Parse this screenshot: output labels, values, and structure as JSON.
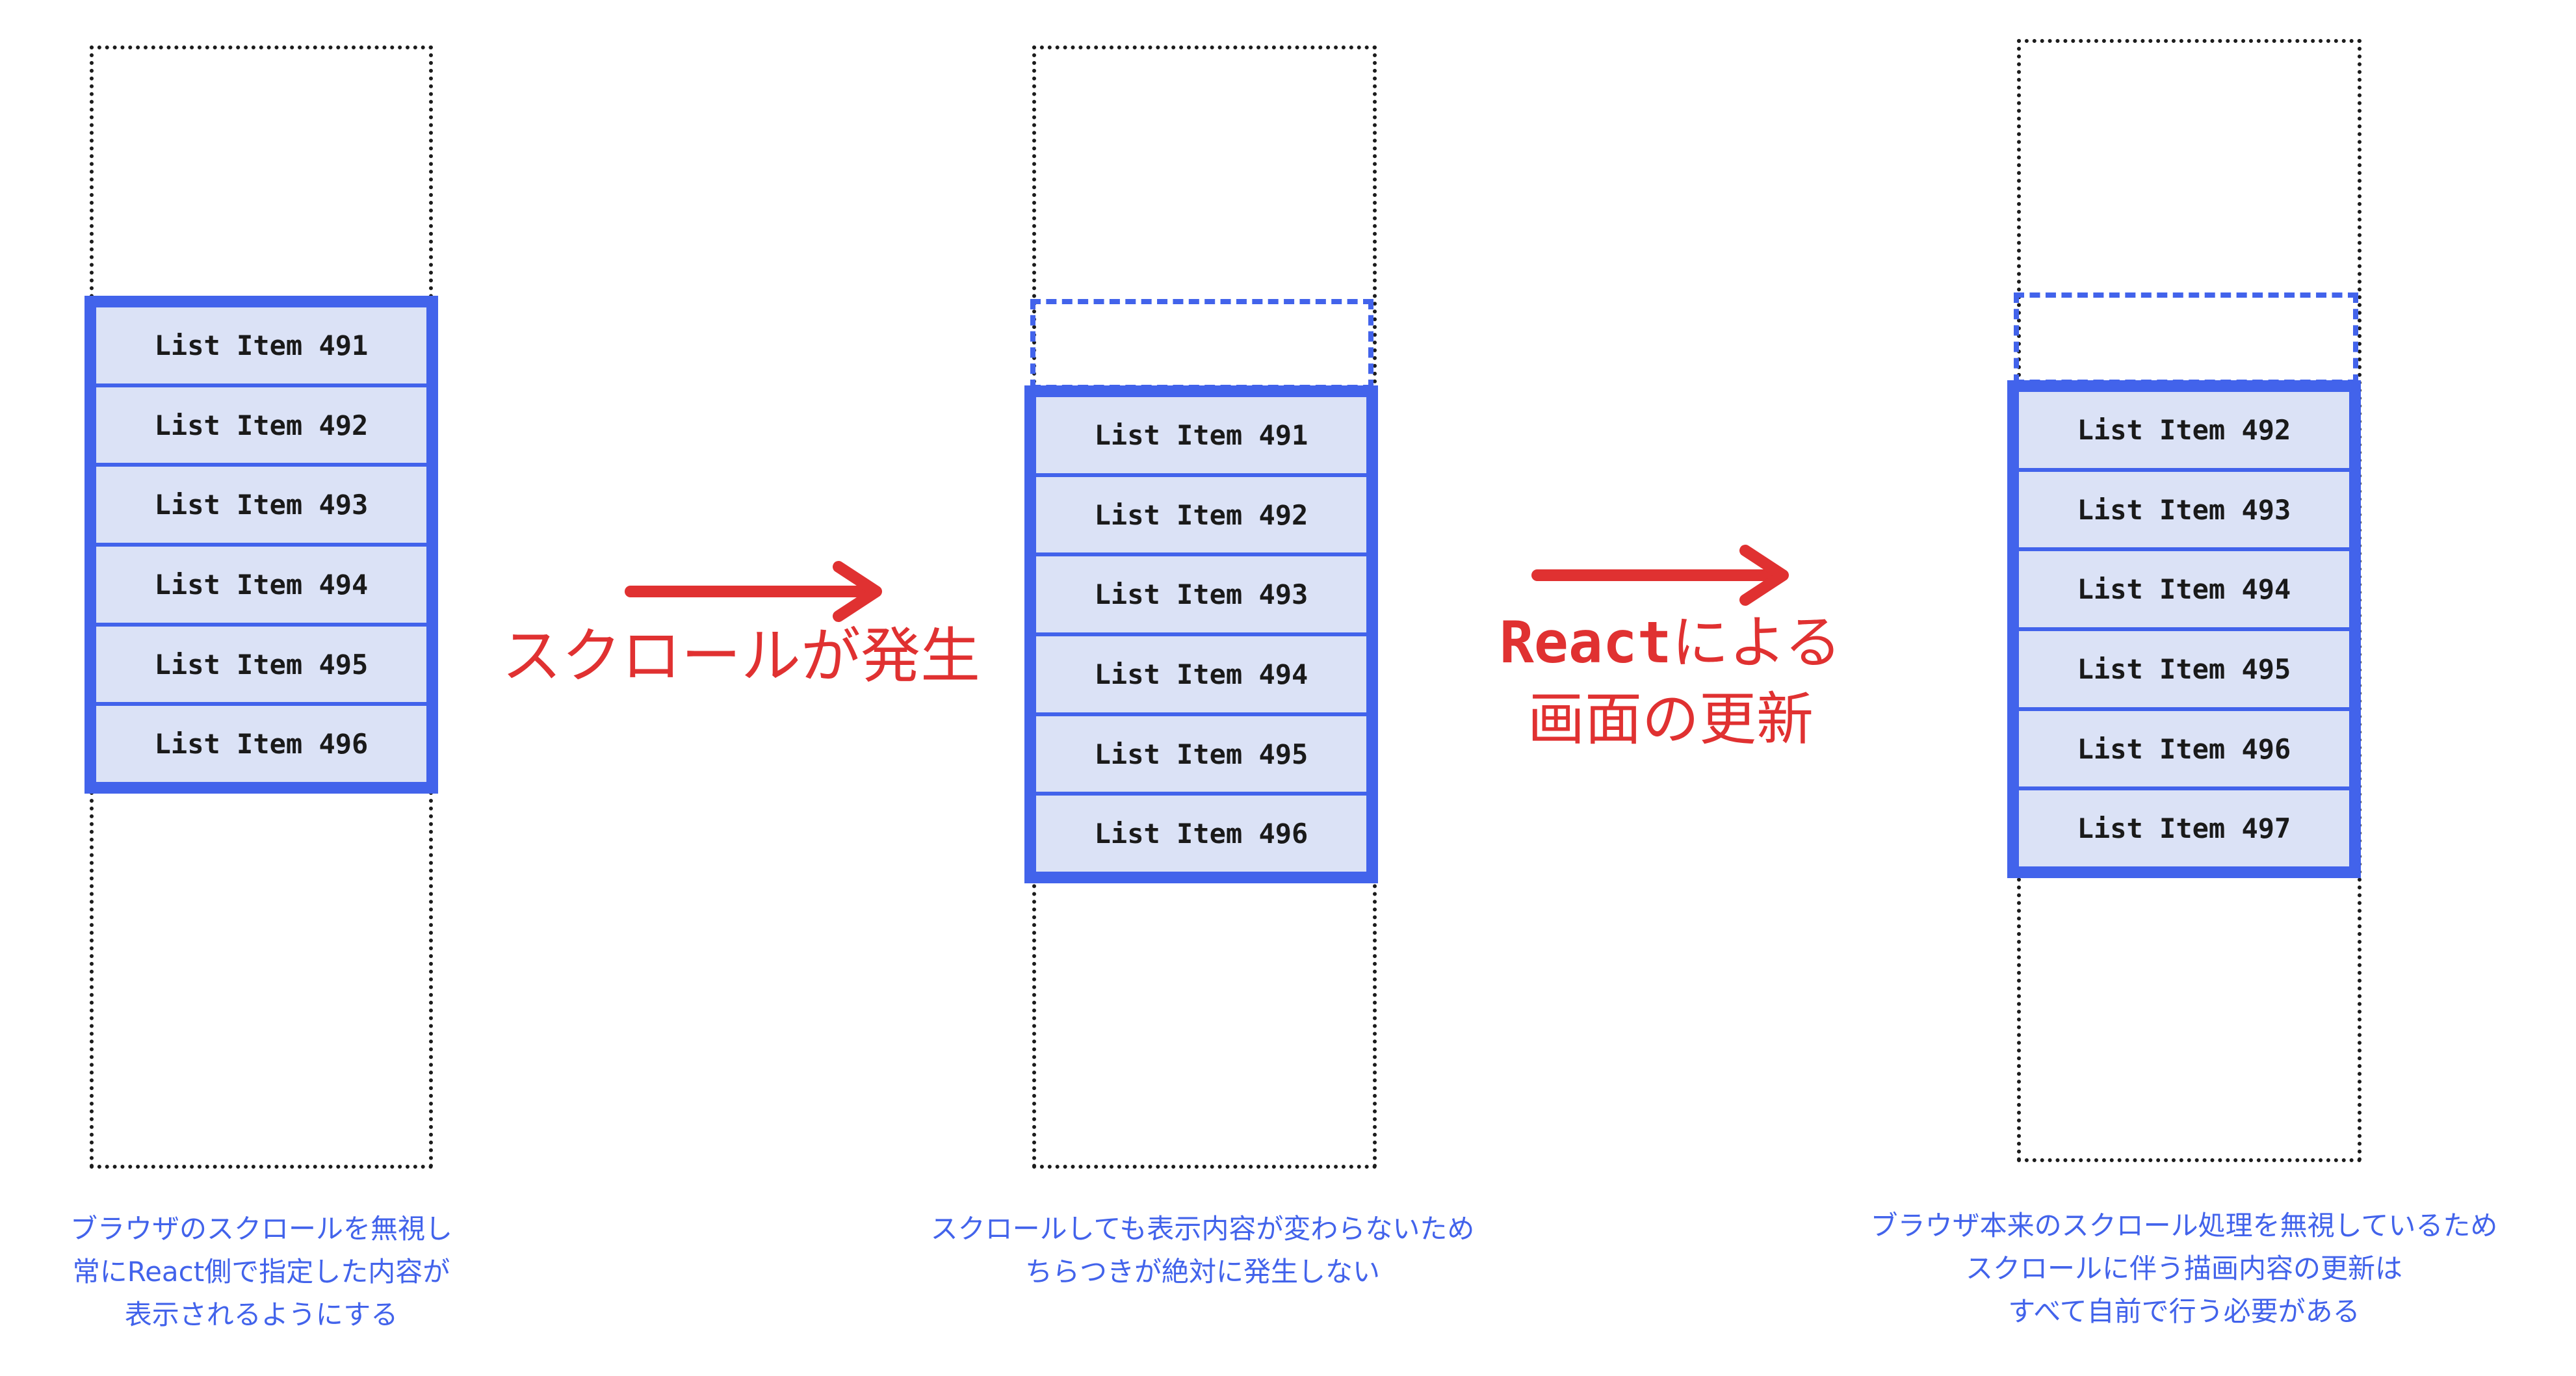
{
  "panels": [
    {
      "items": [
        "List Item 491",
        "List Item 492",
        "List Item 493",
        "List Item 494",
        "List Item 495",
        "List Item 496"
      ],
      "caption": [
        "ブラウザのスクロールを無視し",
        "常にReact側で指定した内容が",
        "表示されるようにする"
      ]
    },
    {
      "items": [
        "List Item 491",
        "List Item 492",
        "List Item 493",
        "List Item 494",
        "List Item 495",
        "List Item 496"
      ],
      "caption": [
        "スクロールしても表示内容が変わらないため",
        "ちらつきが絶対に発生しない"
      ]
    },
    {
      "items": [
        "List Item 492",
        "List Item 493",
        "List Item 494",
        "List Item 495",
        "List Item 496",
        "List Item 497"
      ],
      "caption": [
        "ブラウザ本来のスクロール処理を無視しているため",
        "スクロールに伴う描画内容の更新は",
        "すべて自前で行う必要がある"
      ]
    }
  ],
  "arrows": [
    {
      "label": "スクロールが発生"
    },
    {
      "label_react": "React",
      "label_rest": "による",
      "label_line2": "画面の更新"
    }
  ],
  "colors": {
    "accent_blue": "#4263eb",
    "item_fill": "#dbe2f6",
    "arrow_red": "#e03131"
  }
}
